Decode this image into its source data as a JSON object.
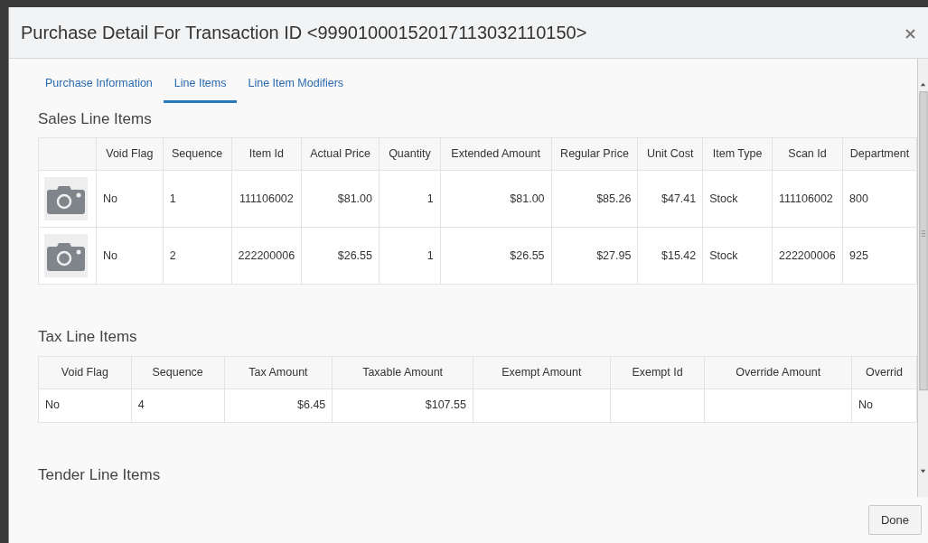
{
  "dialog": {
    "title": "Purchase Detail For Transaction ID <99901000152017113032110150>"
  },
  "tabs": [
    {
      "label": "Purchase Information",
      "selected": false
    },
    {
      "label": "Line Items",
      "selected": true
    },
    {
      "label": "Line Item Modifiers",
      "selected": false
    }
  ],
  "sections": [
    {
      "title": "Sales Line Items",
      "table": {
        "columns": [
          {
            "kind": "image"
          },
          {
            "label": "Void Flag",
            "kind": "text"
          },
          {
            "label": "Sequence",
            "kind": "text"
          },
          {
            "label": "Item Id",
            "kind": "center"
          },
          {
            "label": "Actual Price",
            "kind": "amount"
          },
          {
            "label": "Quantity",
            "kind": "amount"
          },
          {
            "label": "Extended Amount",
            "kind": "amount"
          },
          {
            "label": "Regular Price",
            "kind": "amount"
          },
          {
            "label": "Unit Cost",
            "kind": "amount"
          },
          {
            "label": "Item Type",
            "kind": "text"
          },
          {
            "label": "Scan Id",
            "kind": "text"
          },
          {
            "label": "Department",
            "kind": "text"
          }
        ],
        "rows": [
          [
            "",
            "No",
            "1",
            "111106002",
            "$81.00",
            "1",
            "$81.00",
            "$85.26",
            "$47.41",
            "Stock",
            "111106002",
            "800"
          ],
          [
            "",
            "No",
            "2",
            "222200006",
            "$26.55",
            "1",
            "$26.55",
            "$27.95",
            "$15.42",
            "Stock",
            "222200006",
            "925"
          ]
        ]
      }
    },
    {
      "title": "Tax Line Items",
      "table": {
        "columns": [
          {
            "label": "Void Flag",
            "kind": "text"
          },
          {
            "label": "Sequence",
            "kind": "text"
          },
          {
            "label": "Tax Amount",
            "kind": "amount"
          },
          {
            "label": "Taxable Amount",
            "kind": "amount"
          },
          {
            "label": "Exempt Amount",
            "kind": "amount"
          },
          {
            "label": "Exempt Id",
            "kind": "text"
          },
          {
            "label": "Override Amount",
            "kind": "amount"
          },
          {
            "label": "Overrid",
            "kind": "text"
          }
        ],
        "rows": [
          [
            "No",
            "4",
            "$6.45",
            "$107.55",
            "",
            "",
            "",
            "No"
          ]
        ]
      }
    },
    {
      "title": "Tender Line Items"
    }
  ],
  "footer": {
    "button": "Done"
  }
}
